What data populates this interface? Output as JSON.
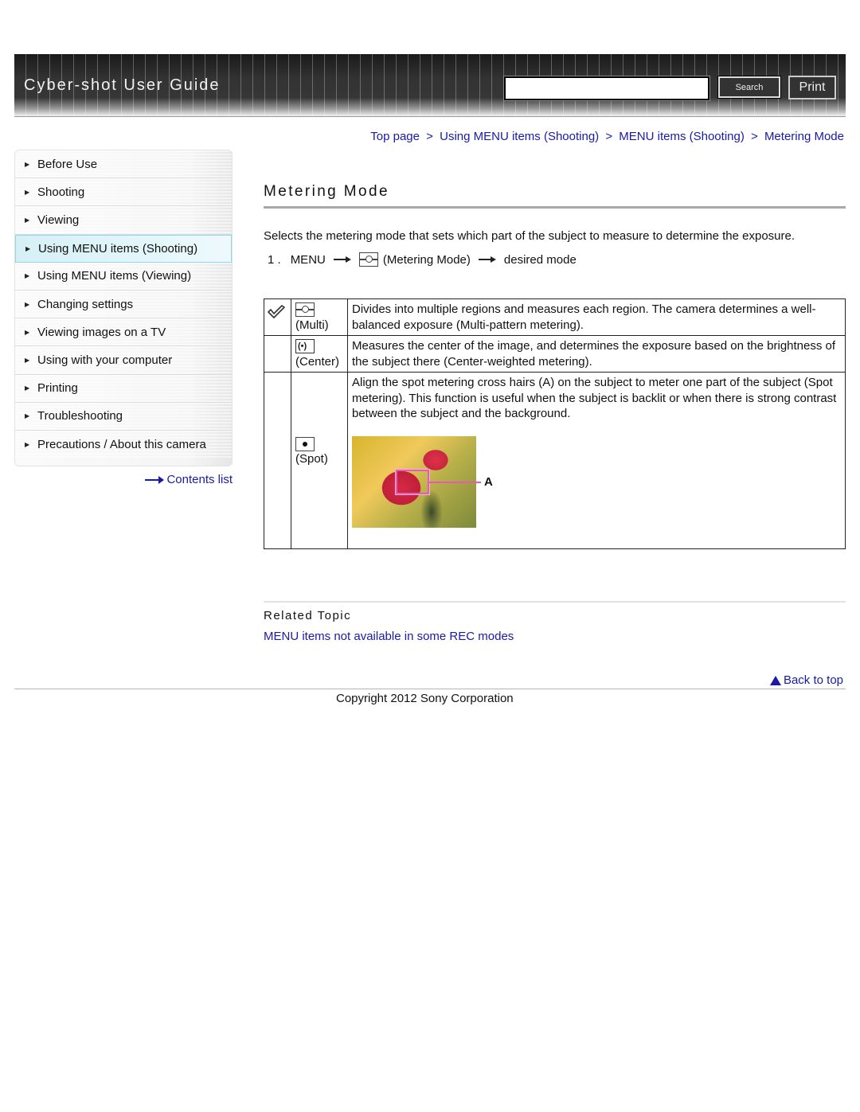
{
  "header": {
    "app_title": "Cyber-shot User Guide",
    "search_input_value": "",
    "search_button_label": "Search",
    "print_button_label": "Print"
  },
  "breadcrumb": {
    "items": [
      "Top page",
      "Using MENU items (Shooting)",
      "MENU items (Shooting)",
      "Metering Mode"
    ],
    "separator": ">"
  },
  "sidebar": {
    "items": [
      {
        "label": "Before Use",
        "active": false
      },
      {
        "label": "Shooting",
        "active": false
      },
      {
        "label": "Viewing",
        "active": false
      },
      {
        "label": "Using MENU items (Shooting)",
        "active": true
      },
      {
        "label": "Using MENU items (Viewing)",
        "active": false
      },
      {
        "label": "Changing settings",
        "active": false
      },
      {
        "label": "Viewing images on a TV",
        "active": false
      },
      {
        "label": "Using with your computer",
        "active": false
      },
      {
        "label": "Printing",
        "active": false
      },
      {
        "label": "Troubleshooting",
        "active": false
      },
      {
        "label": "Precautions / About this camera",
        "active": false
      }
    ],
    "contents_link": "Contents list"
  },
  "main": {
    "title": "Metering Mode",
    "intro": "Selects the metering mode that sets which part of the subject to measure to determine the exposure.",
    "step": {
      "number": "1 .",
      "menu": "MENU",
      "icon": "metering-multi-icon",
      "item": "(Metering Mode)",
      "target": "desired mode"
    },
    "modes": [
      {
        "default": true,
        "icon": "metering-multi-icon",
        "name": "(Multi)",
        "description": "Divides into multiple regions and measures each region. The camera determines a well-balanced exposure (Multi-pattern metering)."
      },
      {
        "default": false,
        "icon": "metering-center-icon",
        "name": "(Center)",
        "description": "Measures the center of the image, and determines the exposure based on the brightness of the subject there (Center-weighted metering)."
      },
      {
        "default": false,
        "icon": "metering-spot-icon",
        "name": "(Spot)",
        "description": "Align the spot metering cross hairs (A) on the subject to meter one part of the subject (Spot metering). This function is useful when the subject is backlit or when there is strong contrast between the subject and the background.",
        "illustration_label": "A"
      }
    ],
    "related": {
      "title": "Related Topic",
      "links": [
        "MENU items not available in some REC modes"
      ]
    }
  },
  "footer": {
    "back_to_top": "Back to top",
    "copyright": "Copyright 2012 Sony Corporation"
  },
  "colors": {
    "link": "#1a1aa6",
    "active_nav": "#d6f0f6",
    "spot_frame": "#e85ab5"
  }
}
